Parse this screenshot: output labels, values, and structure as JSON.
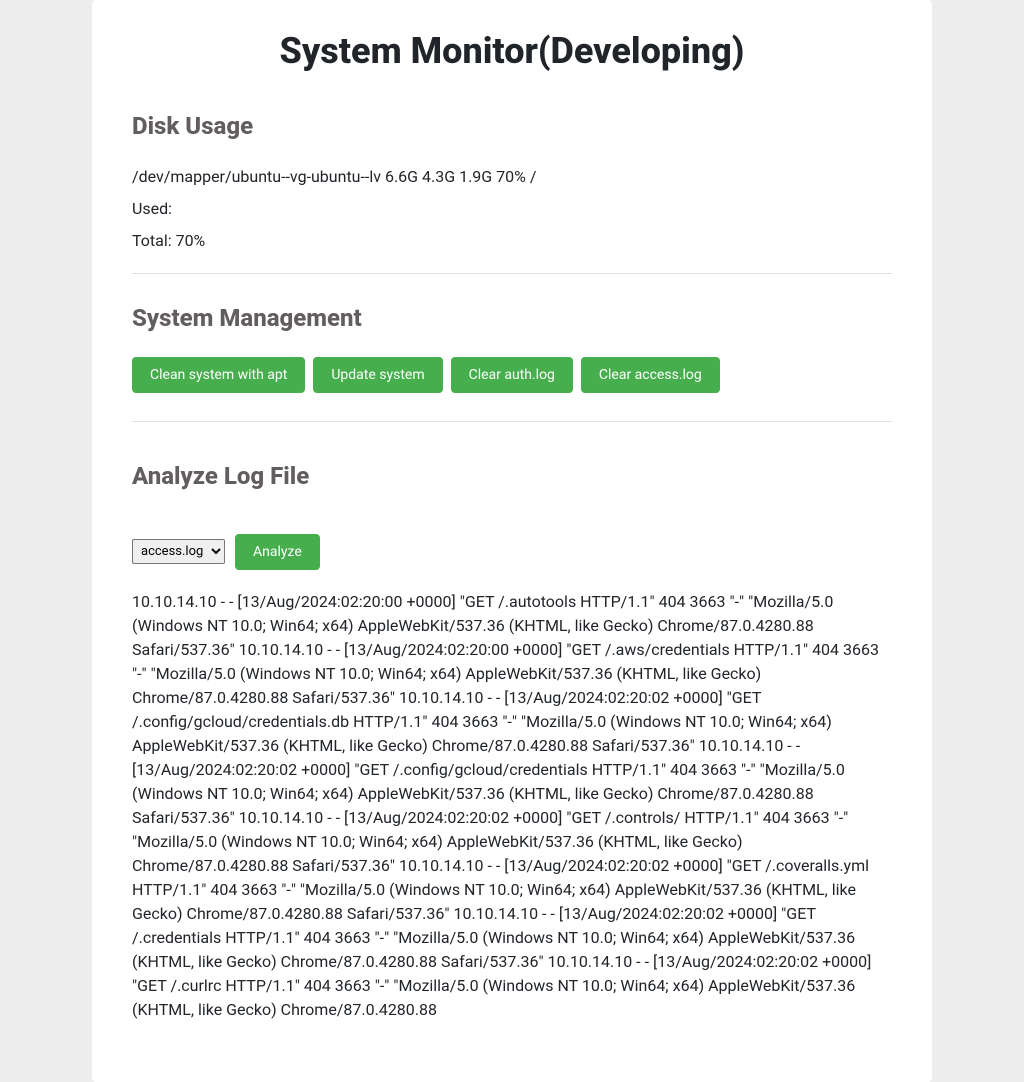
{
  "page_title": "System Monitor(Developing)",
  "disk_usage": {
    "heading": "Disk Usage",
    "line": "/dev/mapper/ubuntu--vg-ubuntu--lv 6.6G 4.3G 1.9G 70% /",
    "used_label": "Used:",
    "total_label": "Total: 70%"
  },
  "system_mgmt": {
    "heading": "System Management",
    "buttons": {
      "clean": "Clean system with apt",
      "update": "Update system",
      "clear_auth": "Clear auth.log",
      "clear_access": "Clear access.log"
    }
  },
  "analyze": {
    "heading": "Analyze Log File",
    "select_value": "access.log",
    "analyze_button": "Analyze",
    "log_output": "10.10.14.10 - - [13/Aug/2024:02:20:00 +0000] \"GET /.autotools HTTP/1.1\" 404 3663 \"-\" \"Mozilla/5.0 (Windows NT 10.0; Win64; x64) AppleWebKit/537.36 (KHTML, like Gecko) Chrome/87.0.4280.88 Safari/537.36\" 10.10.14.10 - - [13/Aug/2024:02:20:00 +0000] \"GET /.aws/credentials HTTP/1.1\" 404 3663 \"-\" \"Mozilla/5.0 (Windows NT 10.0; Win64; x64) AppleWebKit/537.36 (KHTML, like Gecko) Chrome/87.0.4280.88 Safari/537.36\" 10.10.14.10 - - [13/Aug/2024:02:20:02 +0000] \"GET /.config/gcloud/credentials.db HTTP/1.1\" 404 3663 \"-\" \"Mozilla/5.0 (Windows NT 10.0; Win64; x64) AppleWebKit/537.36 (KHTML, like Gecko) Chrome/87.0.4280.88 Safari/537.36\" 10.10.14.10 - - [13/Aug/2024:02:20:02 +0000] \"GET /.config/gcloud/credentials HTTP/1.1\" 404 3663 \"-\" \"Mozilla/5.0 (Windows NT 10.0; Win64; x64) AppleWebKit/537.36 (KHTML, like Gecko) Chrome/87.0.4280.88 Safari/537.36\" 10.10.14.10 - - [13/Aug/2024:02:20:02 +0000] \"GET /.controls/ HTTP/1.1\" 404 3663 \"-\" \"Mozilla/5.0 (Windows NT 10.0; Win64; x64) AppleWebKit/537.36 (KHTML, like Gecko) Chrome/87.0.4280.88 Safari/537.36\" 10.10.14.10 - - [13/Aug/2024:02:20:02 +0000] \"GET /.coveralls.yml HTTP/1.1\" 404 3663 \"-\" \"Mozilla/5.0 (Windows NT 10.0; Win64; x64) AppleWebKit/537.36 (KHTML, like Gecko) Chrome/87.0.4280.88 Safari/537.36\" 10.10.14.10 - - [13/Aug/2024:02:20:02 +0000] \"GET /.credentials HTTP/1.1\" 404 3663 \"-\" \"Mozilla/5.0 (Windows NT 10.0; Win64; x64) AppleWebKit/537.36 (KHTML, like Gecko) Chrome/87.0.4280.88 Safari/537.36\" 10.10.14.10 - - [13/Aug/2024:02:20:02 +0000] \"GET /.curlrc HTTP/1.1\" 404 3663 \"-\" \"Mozilla/5.0 (Windows NT 10.0; Win64; x64) AppleWebKit/537.36 (KHTML, like Gecko) Chrome/87.0.4280.88"
  }
}
